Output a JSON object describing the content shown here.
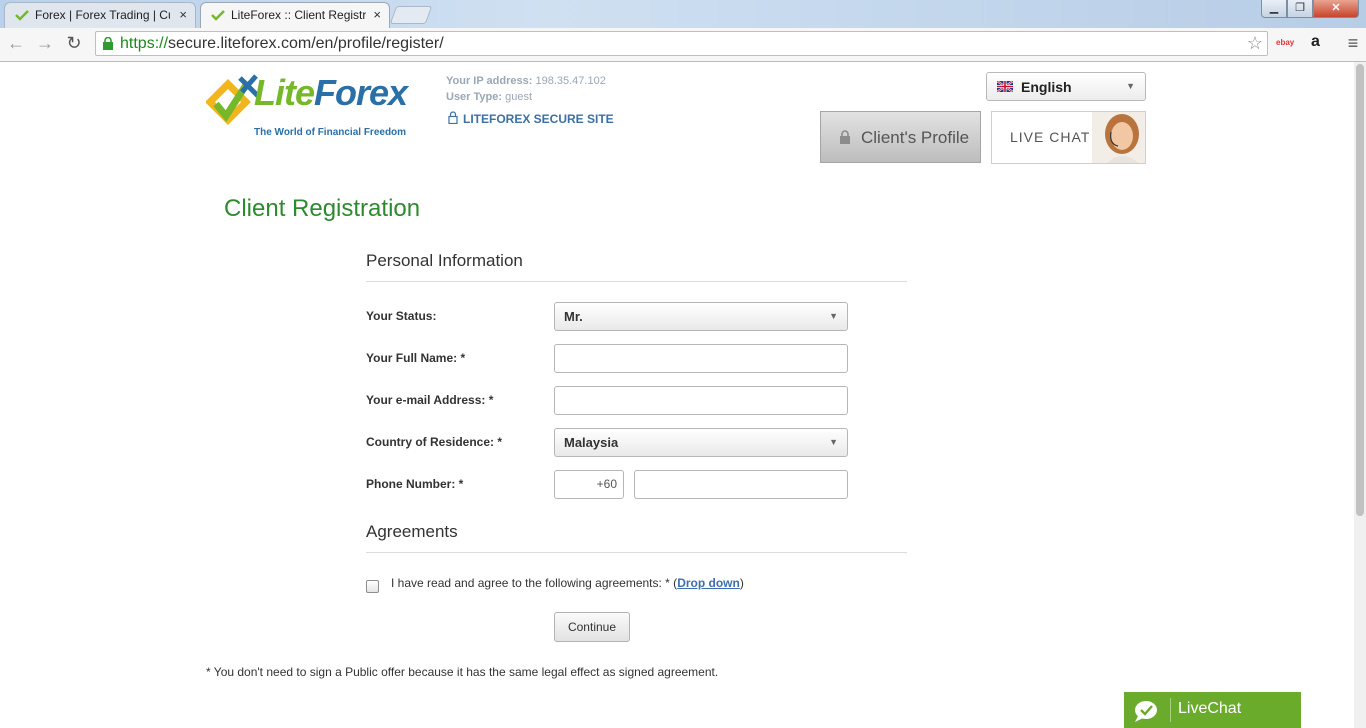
{
  "browser": {
    "tabs": [
      {
        "title": "Forex | Forex Trading | Cur",
        "active": false
      },
      {
        "title": "LiteForex :: Client Registrat",
        "active": true
      }
    ],
    "tab_close": "×",
    "url_scheme": "https://",
    "url_rest": "secure.liteforex.com/en/profile/register/",
    "extensions": [
      "ebay",
      "a"
    ]
  },
  "header": {
    "logo_text_lite": "Lite",
    "logo_text_forex": "Forex",
    "logo_tagline": "The World of Financial Freedom",
    "ip_label": "Your IP address:",
    "ip_value": "198.35.47.102",
    "user_type_label": "User Type:",
    "user_type_value": "guest",
    "secure_site": "LITEFOREX SECURE SITE",
    "language": "English",
    "client_profile": "Client's Profile",
    "live_chat": "LIVE CHAT"
  },
  "page": {
    "title": "Client Registration"
  },
  "personal": {
    "section_title": "Personal Information",
    "status_label": "Your Status:",
    "status_value": "Mr.",
    "full_name_label": "Your Full Name: *",
    "full_name_value": "",
    "email_label": "Your e-mail Address: *",
    "email_value": "",
    "country_label": "Country of Residence: *",
    "country_value": "Malaysia",
    "phone_label": "Phone Number: *",
    "phone_code": "+60",
    "phone_value": ""
  },
  "agreements": {
    "section_title": "Agreements",
    "text_before": "I have read and agree to the following agreements: * (",
    "link_text": "Drop down",
    "text_after": ")",
    "checked": false
  },
  "actions": {
    "continue": "Continue"
  },
  "footnote": "* You don't need to sign a Public offer because it has the same legal effect as signed agreement.",
  "widget": {
    "livechat": "LiveChat"
  },
  "colors": {
    "title_green": "#2e8a2e",
    "livechat_green": "#6bab2c",
    "link_blue": "#3d6fb0"
  }
}
